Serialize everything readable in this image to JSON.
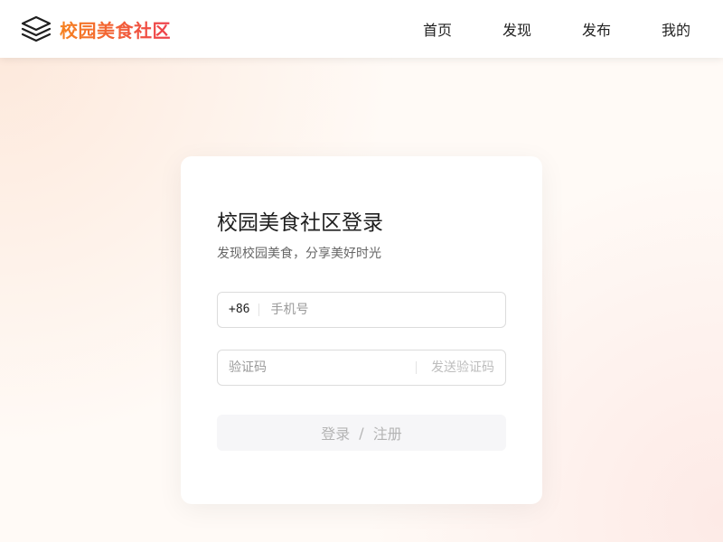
{
  "header": {
    "brand_name": "校园美食社区",
    "logo_icon": "layers-icon",
    "nav": [
      {
        "label": "首页"
      },
      {
        "label": "发现"
      },
      {
        "label": "发布"
      },
      {
        "label": "我的"
      }
    ]
  },
  "login": {
    "title": "校园美食社区登录",
    "subtitle": "发现校园美食，分享美好时光",
    "phone_prefix": "+86",
    "phone_placeholder": "手机号",
    "code_placeholder": "验证码",
    "send_code_label": "发送验证码",
    "submit_login": "登录",
    "submit_separator": "/",
    "submit_register": "注册"
  },
  "colors": {
    "brand_gradient_start": "#f6821f",
    "brand_gradient_end": "#ee3f4d",
    "submit_bg": "#f6f6f8",
    "disabled_text": "#b4b4b4"
  }
}
